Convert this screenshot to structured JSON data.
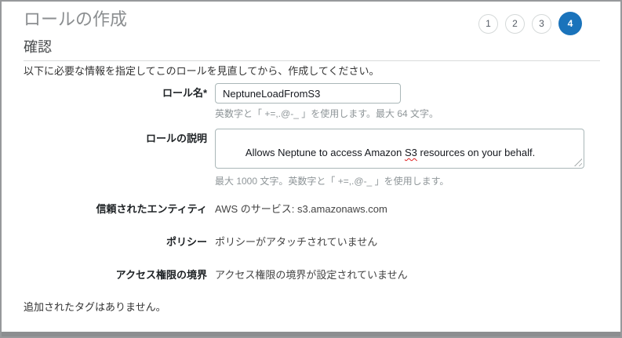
{
  "header": {
    "title": "ロールの作成",
    "steps": [
      {
        "label": "1",
        "state": "inactive"
      },
      {
        "label": "2",
        "state": "inactive"
      },
      {
        "label": "3",
        "state": "inactive"
      },
      {
        "label": "4",
        "state": "active"
      }
    ],
    "active_step": "4"
  },
  "section": {
    "title": "確認",
    "intro": "以下に必要な情報を指定してこのロールを見直してから、作成してください。"
  },
  "form": {
    "role_name": {
      "label": "ロール名*",
      "value": "NeptuneLoadFromS3",
      "help": "英数字と「 +=,.@-_ 」を使用します。最大 64 文字。"
    },
    "role_description": {
      "label": "ロールの説明",
      "text_before": "Allows Neptune to access Amazon ",
      "text_misspelled": "S3",
      "text_after": " resources on your behalf.",
      "help": "最大 1000 文字。英数字と「 +=,.@-_ 」を使用します。"
    },
    "trusted_entities": {
      "label": "信頼されたエンティティ",
      "value": "AWS のサービス: s3.amazonaws.com"
    },
    "policies": {
      "label": "ポリシー",
      "value": "ポリシーがアタッチされていません"
    },
    "permissions_boundary": {
      "label": "アクセス権限の境界",
      "value": "アクセス権限の境界が設定されていません"
    }
  },
  "tags_note": "追加されたタグはありません。",
  "colors": {
    "accent_blue": "#1a73bb",
    "frame_border": "#97999b",
    "bottom_bar": "#8c8e90",
    "title_gray": "#8b8e90",
    "helper_gray": "#8f9699",
    "spellcheck_red": "#e02020"
  }
}
